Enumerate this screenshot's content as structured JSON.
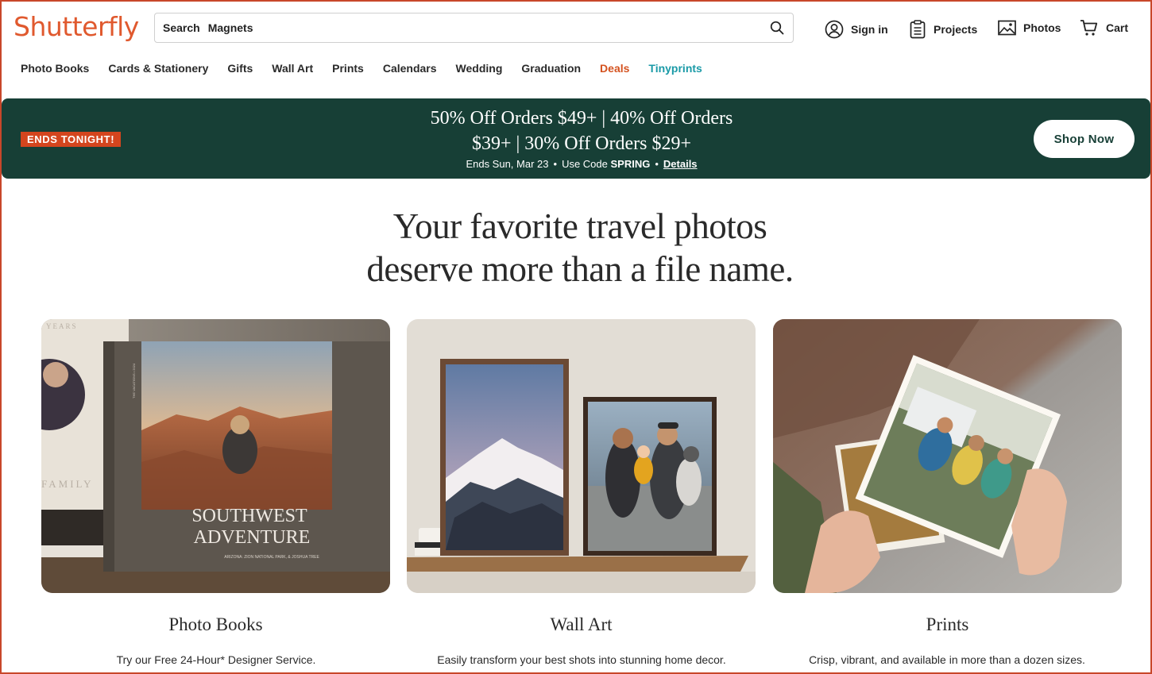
{
  "header": {
    "logo": "Shutterfly",
    "search": {
      "label": "Search",
      "value": "Magnets"
    },
    "utility": {
      "sign_in": "Sign in",
      "projects": "Projects",
      "photos": "Photos",
      "cart": "Cart"
    }
  },
  "nav": [
    "Photo Books",
    "Cards & Stationery",
    "Gifts",
    "Wall Art",
    "Prints",
    "Calendars",
    "Wedding",
    "Graduation",
    "Deals",
    "Tinyprints"
  ],
  "colors": {
    "brand": "#e0592e",
    "deals": "#d4521f",
    "tinyprints": "#1a9aa7",
    "promo_bg": "#173f36",
    "ends_badge": "#d4451e"
  },
  "promo": {
    "badge": "ENDS TONIGHT!",
    "line1": "50% Off Orders $49+ | 40% Off Orders",
    "line2": "$39+ | 30% Off Orders $29+",
    "ends": "Ends Sun, Mar 23",
    "code_prefix": "Use Code",
    "code": "SPRING",
    "details": "Details",
    "cta": "Shop Now"
  },
  "hero": {
    "line1": "Your favorite travel photos",
    "line2": "deserve more than a file name."
  },
  "cards": [
    {
      "title": "Photo Books",
      "desc": "Try our Free 24-Hour* Designer Service.",
      "image_text": {
        "line1": "SOUTHWEST",
        "line2": "ADVENTURE",
        "small": "ARIZONA: ZION NATIONAL PARK, & JOSHUA TREE",
        "spine": "FAMILY",
        "top": "YEARS",
        "vertical": "THE VACATIONS • 2024"
      }
    },
    {
      "title": "Wall Art",
      "desc": "Easily transform your best shots into stunning home decor."
    },
    {
      "title": "Prints",
      "desc": "Crisp, vibrant, and available in more than a dozen sizes."
    }
  ]
}
